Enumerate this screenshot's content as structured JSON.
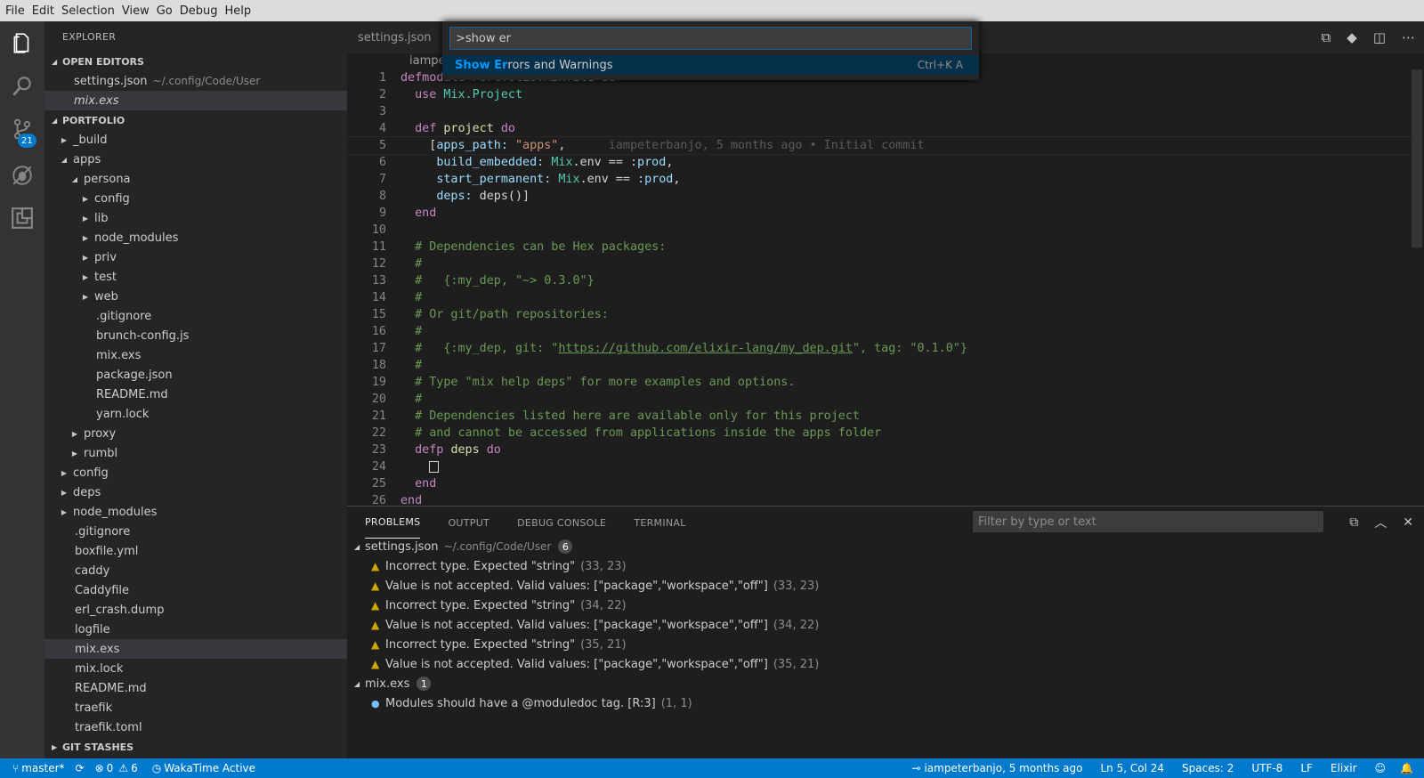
{
  "menu": [
    "File",
    "Edit",
    "Selection",
    "View",
    "Go",
    "Debug",
    "Help"
  ],
  "activity": {
    "scm_badge": "21"
  },
  "sidebar": {
    "title": "EXPLORER",
    "open_editors_title": "OPEN EDITORS",
    "open_editors": [
      {
        "name": "settings.json",
        "path": "~/.config/Code/User"
      },
      {
        "name": "mix.exs"
      }
    ],
    "folder_title": "PORTFOLIO",
    "tree": [
      "_build",
      "apps",
      "persona",
      "config",
      "lib",
      "node_modules",
      "priv",
      "test",
      "web",
      ".gitignore",
      "brunch-config.js",
      "mix.exs",
      "package.json",
      "README.md",
      "yarn.lock",
      "proxy",
      "rumbl",
      "config",
      "deps",
      "node_modules",
      ".gitignore",
      "boxfile.yml",
      "caddy",
      "Caddyfile",
      "erl_crash.dump",
      "logfile",
      "mix.exs",
      "mix.lock",
      "README.md",
      "traefik",
      "traefik.toml"
    ],
    "git_stashes_title": "GIT STASHES"
  },
  "tab": {
    "label": "settings.json"
  },
  "breadcrumb": "iampet",
  "palette": {
    "input_value": ">show er",
    "item_match": "Show Er",
    "item_rest": "rors and Warnings",
    "item_keybinding": "Ctrl+K A"
  },
  "editor": {
    "line_numbers": [
      "1",
      "2",
      "3",
      "4",
      "5",
      "6",
      "7",
      "8",
      "9",
      "10",
      "11",
      "12",
      "13",
      "14",
      "15",
      "16",
      "17",
      "18",
      "19",
      "20",
      "21",
      "22",
      "23",
      "24",
      "25",
      "26"
    ],
    "blame": "iampeterbanjo, 5 months ago • Initial commit"
  },
  "panel": {
    "tabs": [
      "PROBLEMS",
      "OUTPUT",
      "DEBUG CONSOLE",
      "TERMINAL"
    ],
    "filter_placeholder": "Filter by type or text",
    "groups": [
      {
        "file": "settings.json",
        "path": "~/.config/Code/User",
        "count": "6",
        "items": [
          {
            "msg": "Incorrect type. Expected \"string\"",
            "pos": "(33, 23)"
          },
          {
            "msg": "Value is not accepted. Valid values: [\"package\",\"workspace\",\"off\"]",
            "pos": "(33, 23)"
          },
          {
            "msg": "Incorrect type. Expected \"string\"",
            "pos": "(34, 22)"
          },
          {
            "msg": "Value is not accepted. Valid values: [\"package\",\"workspace\",\"off\"]",
            "pos": "(34, 22)"
          },
          {
            "msg": "Incorrect type. Expected \"string\"",
            "pos": "(35, 21)"
          },
          {
            "msg": "Value is not accepted. Valid values: [\"package\",\"workspace\",\"off\"]",
            "pos": "(35, 21)"
          }
        ]
      },
      {
        "file": "mix.exs",
        "count": "1",
        "items": [
          {
            "msg": "Modules should have a @moduledoc tag. [R:3]",
            "pos": "(1, 1)"
          }
        ]
      }
    ]
  },
  "status": {
    "branch": "master*",
    "errors": "0",
    "warnings": "6",
    "wakatime": "WakaTime Active",
    "blame": "iampeterbanjo, 5 months ago",
    "cursor": "Ln 5, Col 24",
    "spaces": "Spaces: 2",
    "encoding": "UTF-8",
    "eol": "LF",
    "language": "Elixir"
  }
}
